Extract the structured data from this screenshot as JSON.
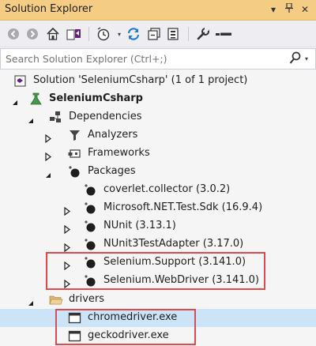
{
  "window": {
    "title": "Solution Explorer"
  },
  "search": {
    "placeholder": "Search Solution Explorer (Ctrl+;)"
  },
  "tree": {
    "solution": "Solution 'SeleniumCsharp' (1 of 1 project)",
    "project": "SeleniumCsharp",
    "dependencies": "Dependencies",
    "analyzers": "Analyzers",
    "frameworks": "Frameworks",
    "packages": "Packages",
    "pkg_coverlet": "coverlet.collector (3.0.2)",
    "pkg_testsdk": "Microsoft.NET.Test.Sdk (16.9.4)",
    "pkg_nunit": "NUnit (3.13.1)",
    "pkg_nunit3adapter": "NUnit3TestAdapter (3.17.0)",
    "pkg_selenium_support": "Selenium.Support (3.141.0)",
    "pkg_selenium_webdriver": "Selenium.WebDriver (3.141.0)",
    "drivers": "drivers",
    "chromedriver": "chromedriver.exe",
    "geckodriver": "geckodriver.exe"
  },
  "colors": {
    "titlebar": "#f5cc84",
    "selection": "#cce4f7",
    "highlight_box": "#e04a4a"
  }
}
